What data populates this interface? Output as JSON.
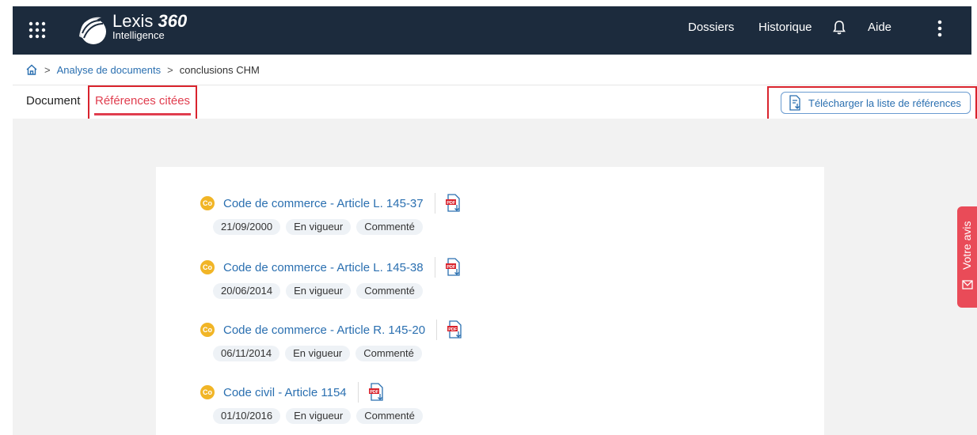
{
  "app": {
    "brand": "Lexis",
    "brand_number": "360",
    "brand_sub": "Intelligence"
  },
  "topnav": {
    "dossiers": "Dossiers",
    "historique": "Historique",
    "aide": "Aide"
  },
  "breadcrumb": {
    "level1": "Analyse de documents",
    "current": "conclusions CHM"
  },
  "tabs": {
    "document": "Document",
    "references": "Références citées"
  },
  "download_button": "Télécharger la liste de références",
  "references": [
    {
      "badge": "Co",
      "title": "Code de commerce - Article L. 145-37",
      "date": "21/09/2000",
      "status": "En vigueur",
      "annotation": "Commenté"
    },
    {
      "badge": "Co",
      "title": "Code de commerce - Article L. 145-38",
      "date": "20/06/2014",
      "status": "En vigueur",
      "annotation": "Commenté"
    },
    {
      "badge": "Co",
      "title": "Code de commerce - Article R. 145-20",
      "date": "06/11/2014",
      "status": "En vigueur",
      "annotation": "Commenté"
    },
    {
      "badge": "Co",
      "title": "Code civil - Article 1154",
      "date": "01/10/2016",
      "status": "En vigueur",
      "annotation": "Commenté"
    }
  ],
  "feedback": "Votre avis",
  "colors": {
    "header": "#1c2b3d",
    "accent": "#e03d4e",
    "link": "#2a6fb0",
    "badge": "#f1b526",
    "highlight": "#d9232d"
  },
  "icons": [
    "apps-grid-icon",
    "logo-swirl-icon",
    "bell-icon",
    "kebab-menu-icon",
    "home-icon",
    "download-list-icon",
    "pdf-download-icon",
    "mail-icon"
  ]
}
